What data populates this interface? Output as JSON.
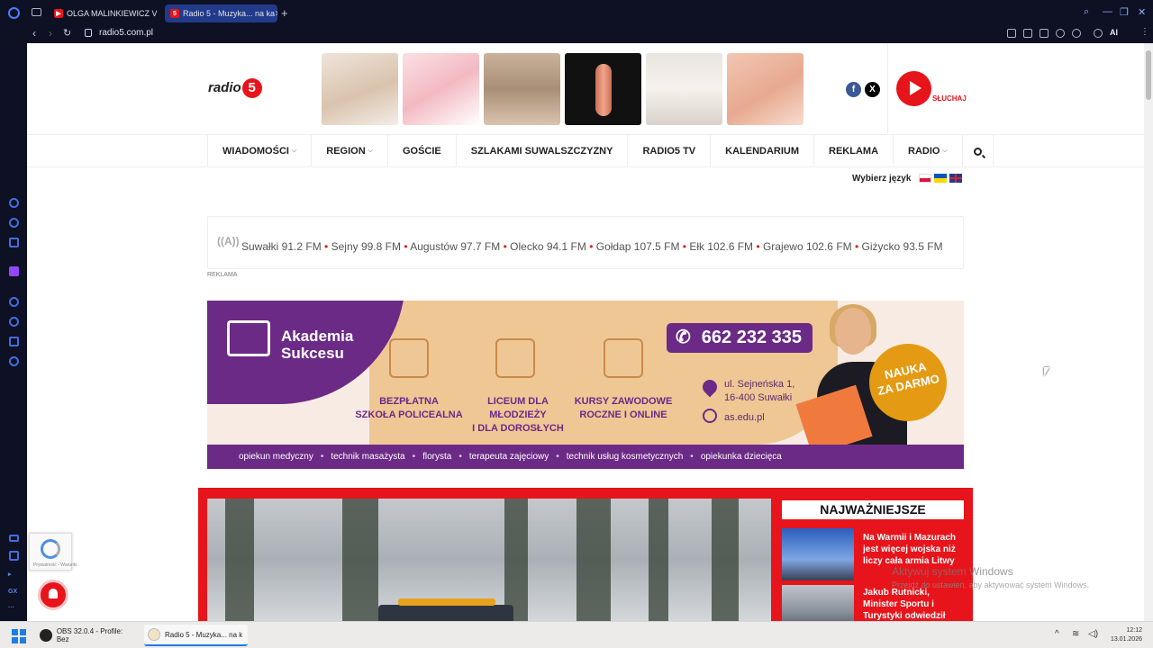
{
  "browser": {
    "tabs": [
      {
        "label": "OLGA MALINKIEWICZ VS",
        "icon": "youtube-icon",
        "color": "#e8141b"
      },
      {
        "label": "Radio 5 - Muzyka... na ka",
        "icon": "radio5-favicon",
        "color": "#e8141b"
      }
    ],
    "new_tab": "+",
    "url": "radio5.com.pl",
    "ai_label": "AI"
  },
  "site": {
    "logo_text": "radio",
    "logo_number": "5",
    "listen_label": "SŁUCHAJ",
    "social": {
      "facebook": "f",
      "x": "X"
    },
    "menu": [
      {
        "label": "WIADOMOŚCI",
        "dropdown": true
      },
      {
        "label": "REGION",
        "dropdown": true
      },
      {
        "label": "GOŚCIE",
        "dropdown": false
      },
      {
        "label": "SZLAKAMI SUWALSZCZYZNY",
        "dropdown": false
      },
      {
        "label": "RADIO5 TV",
        "dropdown": false
      },
      {
        "label": "KALENDARIUM",
        "dropdown": false
      },
      {
        "label": "REKLAMA",
        "dropdown": false
      },
      {
        "label": "RADIO",
        "dropdown": true
      }
    ],
    "language_label": "Wybierz język",
    "frequencies": [
      "Suwałki 91.2 FM",
      "Sejny 99.8 FM",
      "Augustów 97.7 FM",
      "Olecko 94.1 FM",
      "Gołdap 107.5 FM",
      "Ełk 102.6 FM",
      "Grajewo 102.6 FM",
      "Giżycko 93.5 FM"
    ],
    "ad_label": "REKLAMA"
  },
  "banner": {
    "name_line1": "Akademia",
    "name_line2": "Sukcesu",
    "features": [
      {
        "line1": "BEZPŁATNA",
        "line2": "SZKOŁA POLICEALNA"
      },
      {
        "line1": "LICEUM DLA MŁODZIEŻY",
        "line2": "I DLA DOROSŁYCH"
      },
      {
        "line1": "KURSY ZAWODOWE",
        "line2": "ROCZNE I ONLINE"
      }
    ],
    "phone": "662 232 335",
    "address_line1": "ul. Sejneńska 1,",
    "address_line2": "16-400 Suwałki",
    "website": "as.edu.pl",
    "badge_line1": "NAUKA",
    "badge_line2": "ZA DARMO",
    "courses": [
      "opiekun medyczny",
      "technik masażysta",
      "florysta",
      "terapeuta zajęciowy",
      "technik usług kosmetycznych",
      "opiekunka dziecięca"
    ],
    "accent_purple": "#6b2a86",
    "accent_orange": "#e49a12"
  },
  "news": {
    "section_title": "NAJWAŻNIEJSZE",
    "items": [
      {
        "title": "Na Warmii i Mazurach jest więcej wojska niż liczy cała armia Litwy"
      },
      {
        "title": "Jakub Rutnicki, Minister Sportu i Turystyki odwiedził Suwalszczyznę"
      }
    ]
  },
  "overlay": {
    "activate_title": "Aktywuj system Windows",
    "activate_sub": "Przejdź do ustawień, aby aktywować system Windows.",
    "recaptcha_text": "Prywatność - Warunki"
  },
  "taskbar": {
    "apps": [
      {
        "label": "OBS 32.0.4 - Profile: Bez"
      },
      {
        "label": "Radio 5 - Muzyka... na k"
      }
    ],
    "time": "12:12",
    "date": "13.01.2026"
  }
}
